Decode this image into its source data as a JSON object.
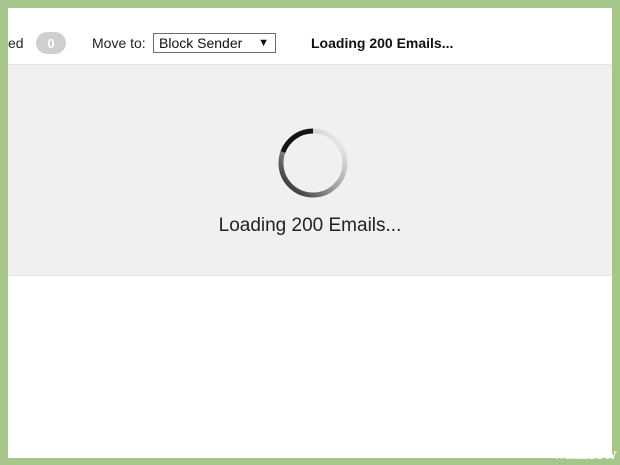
{
  "toolbar": {
    "prev_fragment": "ed",
    "count_badge": "0",
    "move_to_label": "Move to:",
    "move_to_select": {
      "selected": "Block Sender"
    },
    "status_text": "Loading 200 Emails..."
  },
  "main": {
    "loading_text": "Loading 200 Emails..."
  },
  "watermark": {
    "part1": "wiki",
    "part2": "How"
  },
  "icons": {
    "spinner": "loading-spinner-icon",
    "dropdown": "triangle-down-icon"
  },
  "colors": {
    "background": "#a6c58b",
    "panel": "#f0f0f0",
    "badge": "#cfcfcf"
  }
}
